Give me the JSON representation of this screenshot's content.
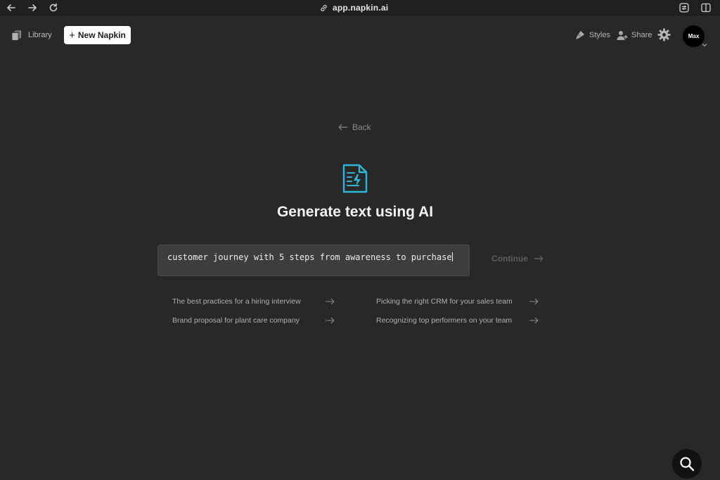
{
  "browser": {
    "url": "app.napkin.ai"
  },
  "header": {
    "library_label": "Library",
    "new_napkin_label": "New Napkin",
    "styles_label": "Styles",
    "share_label": "Share",
    "avatar_text": "Max"
  },
  "main": {
    "back_label": "Back",
    "title": "Generate text using AI",
    "prompt_value": "customer journey with 5 steps from awareness to purchase",
    "continue_label": "Continue",
    "suggestions": [
      "The best practices for a hiring interview",
      "Brand proposal for plant care company",
      "Picking the right CRM for your sales team",
      "Recognizing top performers on your team"
    ]
  },
  "icons": {
    "ai_icon_color": "#2fb6d6"
  }
}
